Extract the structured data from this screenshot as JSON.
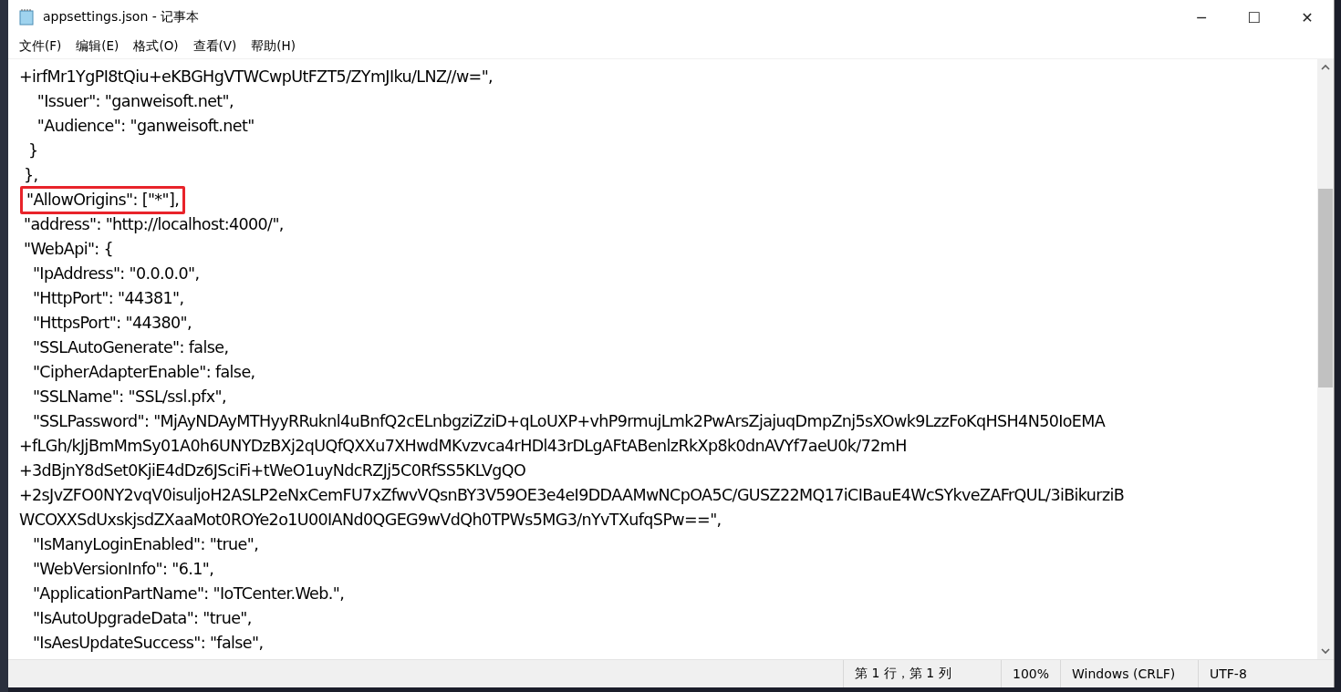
{
  "window": {
    "title": "appsettings.json - 记事本",
    "controls": [
      "─",
      "☐",
      "✕"
    ]
  },
  "menu": [
    {
      "label": "文件(F)"
    },
    {
      "label": "编辑(E)"
    },
    {
      "label": "格式(O)"
    },
    {
      "label": "查看(V)"
    },
    {
      "label": "帮助(H)"
    }
  ],
  "editor": {
    "lines": [
      {
        "text": "+irfMr1YgPI8tQiu+eKBGHgVTWCwpUtFZT5/ZYmJIku/LNZ//w=\",",
        "highlighted": false
      },
      {
        "text": "    \"Issuer\": \"ganweisoft.net\",",
        "highlighted": false
      },
      {
        "text": "    \"Audience\": \"ganweisoft.net\"",
        "highlighted": false
      },
      {
        "text": "  }",
        "highlighted": false
      },
      {
        "text": " },",
        "highlighted": false
      },
      {
        "text": "\"AllowOrigins\": [\"*\"],",
        "highlighted": true
      },
      {
        "text": " \"address\": \"http://localhost:4000/\",",
        "highlighted": false
      },
      {
        "text": " \"WebApi\": {",
        "highlighted": false
      },
      {
        "text": "   \"IpAddress\": \"0.0.0.0\",",
        "highlighted": false
      },
      {
        "text": "   \"HttpPort\": \"44381\",",
        "highlighted": false
      },
      {
        "text": "   \"HttpsPort\": \"44380\",",
        "highlighted": false
      },
      {
        "text": "   \"SSLAutoGenerate\": false,",
        "highlighted": false
      },
      {
        "text": "   \"CipherAdapterEnable\": false,",
        "highlighted": false
      },
      {
        "text": "   \"SSLName\": \"SSL/ssl.pfx\",",
        "highlighted": false
      },
      {
        "text": "   \"SSLPassword\": \"MjAyNDAyMTHyyRRuknl4uBnfQ2cELnbgziZziD+qLoUXP+vhP9rmujLmk2PwArsZjajuqDmpZnj5sXOwk9LzzFoKqHSH4N50IoEMA",
        "highlighted": false
      },
      {
        "text": "+fLGh/kJjBmMmSy01A0h6UNYDzBXj2qUQfQXXu7XHwdMKvzvca4rHDl43rDLgAFtABenlzRkXp8k0dnAVYf7aeU0k/72mH",
        "highlighted": false
      },
      {
        "text": "+3dBjnY8dSet0KjiE4dDz6JSciFi+tWeO1uyNdcRZJj5C0RfSS5KLVgQO",
        "highlighted": false
      },
      {
        "text": "+2sJvZFO0NY2vqV0isuljoH2ASLP2eNxCemFU7xZfwvVQsnBY3V59OE3e4eI9DDAAMwNCpOA5C/GUSZ22MQ17iCIBauE4WcSYkveZAFrQUL/3iBikurziB",
        "highlighted": false
      },
      {
        "text": "WCOXXSdUxskjsdZXaaMot0ROYe2o1U00IANd0QGEG9wVdQh0TPWs5MG3/nYvTXufqSPw==\",",
        "highlighted": false
      },
      {
        "text": "   \"IsManyLoginEnabled\": \"true\",",
        "highlighted": false
      },
      {
        "text": "   \"WebVersionInfo\": \"6.1\",",
        "highlighted": false
      },
      {
        "text": "   \"ApplicationPartName\": \"IoTCenter.Web.\",",
        "highlighted": false
      },
      {
        "text": "   \"IsAutoUpgradeData\": \"true\",",
        "highlighted": false
      },
      {
        "text": "   \"IsAesUpdateSuccess\": \"false\",",
        "highlighted": false
      }
    ]
  },
  "status_bar": {
    "position": "第 1 行，第 1 列",
    "zoom": "100%",
    "line_ending": "Windows (CRLF)",
    "encoding": "UTF-8"
  }
}
